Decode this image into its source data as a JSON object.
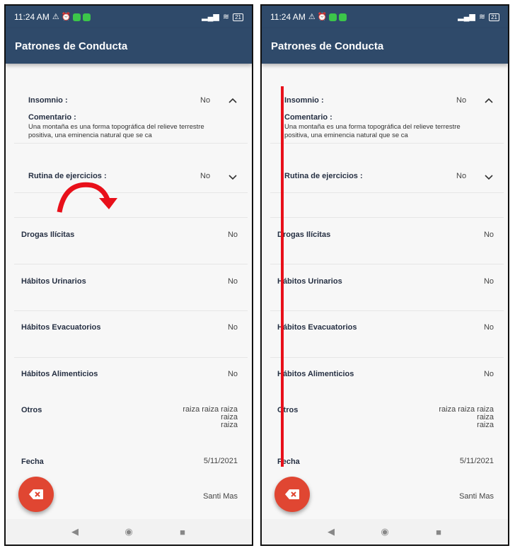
{
  "status_bar": {
    "time": "11:24 AM",
    "battery": "21"
  },
  "app_bar": {
    "title": "Patrones de Conducta"
  },
  "expandable": [
    {
      "label": "Insomnio :",
      "value": "No",
      "expanded": true,
      "comment_label": "Comentario :",
      "comment_text": "Una montaña es una forma topográfica del relieve terrestre positiva, una eminencia natural que se ca"
    },
    {
      "label": "Rutina de ejercicios :",
      "value": "No",
      "expanded": false
    }
  ],
  "rows": [
    {
      "label": "Drogas Ilícitas",
      "value": "No"
    },
    {
      "label": "Hábitos Urinarios",
      "value": "No"
    },
    {
      "label": "Hábitos Evacuatorios",
      "value": "No"
    },
    {
      "label": "Hábitos Alimenticios",
      "value": "No"
    },
    {
      "label": "Otros",
      "value_lines": [
        "raiza raiza raiza",
        "raiza",
        "raiza"
      ]
    },
    {
      "label": "Fecha",
      "value": "5/11/2021"
    },
    {
      "label": "",
      "value": "Santi Mas"
    }
  ],
  "colors": {
    "app_bar": "#2f4a6a",
    "fab": "#e04632",
    "annotation": "#e8101a"
  },
  "icons": {
    "fab": "backspace-icon",
    "nav": [
      "back-icon",
      "home-icon",
      "recents-icon"
    ]
  }
}
